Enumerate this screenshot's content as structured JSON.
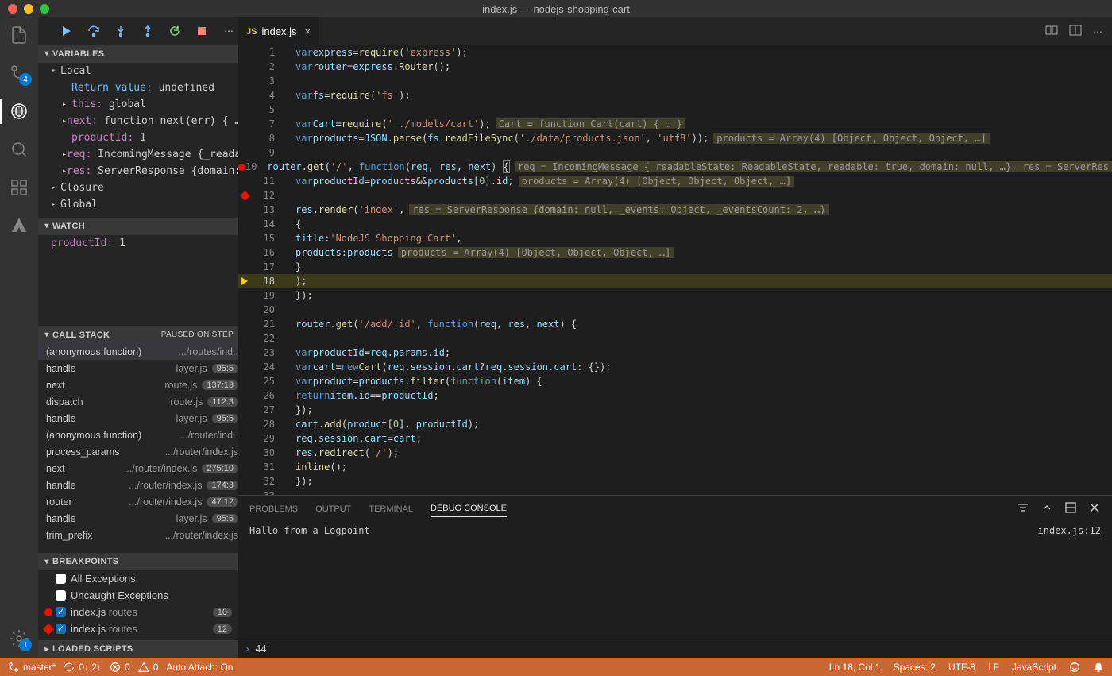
{
  "window": {
    "title": "index.js — nodejs-shopping-cart"
  },
  "activity": {
    "scm_badge": "4",
    "settings_badge": "1"
  },
  "panels": {
    "variables": {
      "title": "Variables",
      "local": "Local",
      "return_label": "Return value:",
      "return_val": "undefined",
      "this_label": "this:",
      "this_val": "global",
      "next_label": "next:",
      "next_val": "function next(err) { … }",
      "pid_label": "productId:",
      "pid_val": "1",
      "req_label": "req:",
      "req_val": "IncomingMessage {_readableSt…",
      "res_label": "res:",
      "res_val": "ServerResponse {domain: null…",
      "closure": "Closure",
      "global": "Global"
    },
    "watch": {
      "title": "Watch",
      "item_label": "productId:",
      "item_val": "1"
    },
    "callstack": {
      "title": "Call Stack",
      "status": "Paused on step",
      "frames": [
        {
          "fn": "(anonymous function)",
          "src": ".../routes/ind..",
          "pos": ""
        },
        {
          "fn": "handle",
          "src": "layer.js",
          "pos": "95:5"
        },
        {
          "fn": "next",
          "src": "route.js",
          "pos": "137:13"
        },
        {
          "fn": "dispatch",
          "src": "route.js",
          "pos": "112:3"
        },
        {
          "fn": "handle",
          "src": "layer.js",
          "pos": "95:5"
        },
        {
          "fn": "(anonymous function)",
          "src": ".../router/ind..",
          "pos": ""
        },
        {
          "fn": "process_params",
          "src": ".../router/index.js",
          "pos": ""
        },
        {
          "fn": "next",
          "src": ".../router/index.js",
          "pos": "275:10"
        },
        {
          "fn": "handle",
          "src": ".../router/index.js",
          "pos": "174:3"
        },
        {
          "fn": "router",
          "src": ".../router/index.js",
          "pos": "47:12"
        },
        {
          "fn": "handle",
          "src": "layer.js",
          "pos": "95:5"
        },
        {
          "fn": "trim_prefix",
          "src": ".../router/index.js",
          "pos": ""
        }
      ]
    },
    "breakpoints": {
      "title": "Breakpoints",
      "all_ex": "All Exceptions",
      "uncaught": "Uncaught Exceptions",
      "items": [
        {
          "file": "index.js",
          "label": "routes",
          "line": "10"
        },
        {
          "file": "index.js",
          "label": "routes",
          "line": "12"
        }
      ]
    },
    "loaded": {
      "title": "Loaded Scripts"
    }
  },
  "tab": {
    "name": "index.js"
  },
  "code": {
    "hint7": "Cart = function Cart(cart) { … }",
    "hint8": "products = Array(4) [Object, Object, Object, …]",
    "hint10a": "req = IncomingMessage {_readableState: ReadableState, readable: true, domain: null, …}, res = ServerRes",
    "hint11": "products = Array(4) [Object, Object, Object, …]",
    "hint13": "res = ServerResponse {domain: null, _events: Object, _eventsCount: 2, …}",
    "hint16": "products = Array(4) [Object, Object, Object, …]"
  },
  "bottomPanel": {
    "tabs": {
      "problems": "Problems",
      "output": "Output",
      "terminal": "Terminal",
      "debug": "Debug Console"
    },
    "message": "Hallo from a Logpoint",
    "source": "index.js:12",
    "repl": "44"
  },
  "status": {
    "branch": "master*",
    "sync": "0↓ 2↑",
    "errors": "0",
    "warnings": "0",
    "autoattach": "Auto Attach: On",
    "pos": "Ln 18, Col 1",
    "spaces": "Spaces: 2",
    "enc": "UTF-8",
    "eol": "LF",
    "lang": "JavaScript"
  }
}
